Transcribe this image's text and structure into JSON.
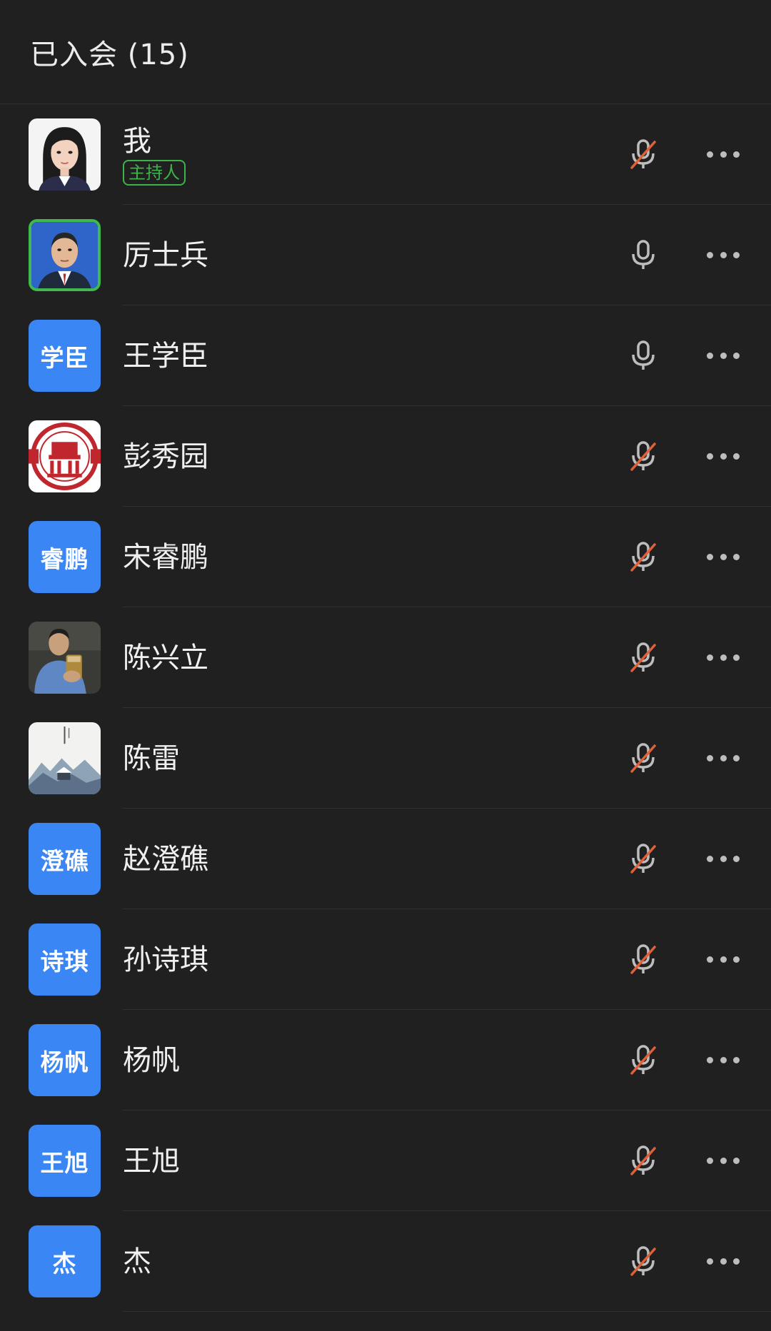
{
  "header": {
    "title": "已入会 (15)"
  },
  "colors": {
    "background": "#202020",
    "avatar_blue": "#3a86f4",
    "host_green": "#3cb34a",
    "speaking_border": "#3fb950",
    "muted_slash": "#e0603a",
    "icon_gray": "#bdbdbd"
  },
  "participants": [
    {
      "name": "我",
      "badge": "主持人",
      "avatar_type": "photo-portrait-woman",
      "mic": "muted"
    },
    {
      "name": "厉士兵",
      "avatar_type": "photo-portrait-man",
      "mic": "on",
      "speaking": true
    },
    {
      "name": "王学臣",
      "avatar_text": "学臣",
      "avatar_type": "text",
      "mic": "on"
    },
    {
      "name": "彭秀园",
      "avatar_type": "logo-emblem",
      "mic": "muted"
    },
    {
      "name": "宋睿鹏",
      "avatar_text": "睿鹏",
      "avatar_type": "text",
      "mic": "muted"
    },
    {
      "name": "陈兴立",
      "avatar_type": "photo-man-drinking",
      "mic": "muted"
    },
    {
      "name": "陈雷",
      "avatar_type": "photo-snow-landscape",
      "mic": "muted"
    },
    {
      "name": "赵澄礁",
      "avatar_text": "澄礁",
      "avatar_type": "text",
      "mic": "muted"
    },
    {
      "name": "孙诗琪",
      "avatar_text": "诗琪",
      "avatar_type": "text",
      "mic": "muted"
    },
    {
      "name": "杨帆",
      "avatar_text": "杨帆",
      "avatar_type": "text",
      "mic": "muted"
    },
    {
      "name": "王旭",
      "avatar_text": "王旭",
      "avatar_type": "text",
      "mic": "muted"
    },
    {
      "name": "杰",
      "avatar_text": "杰",
      "avatar_type": "text",
      "mic": "muted"
    }
  ]
}
